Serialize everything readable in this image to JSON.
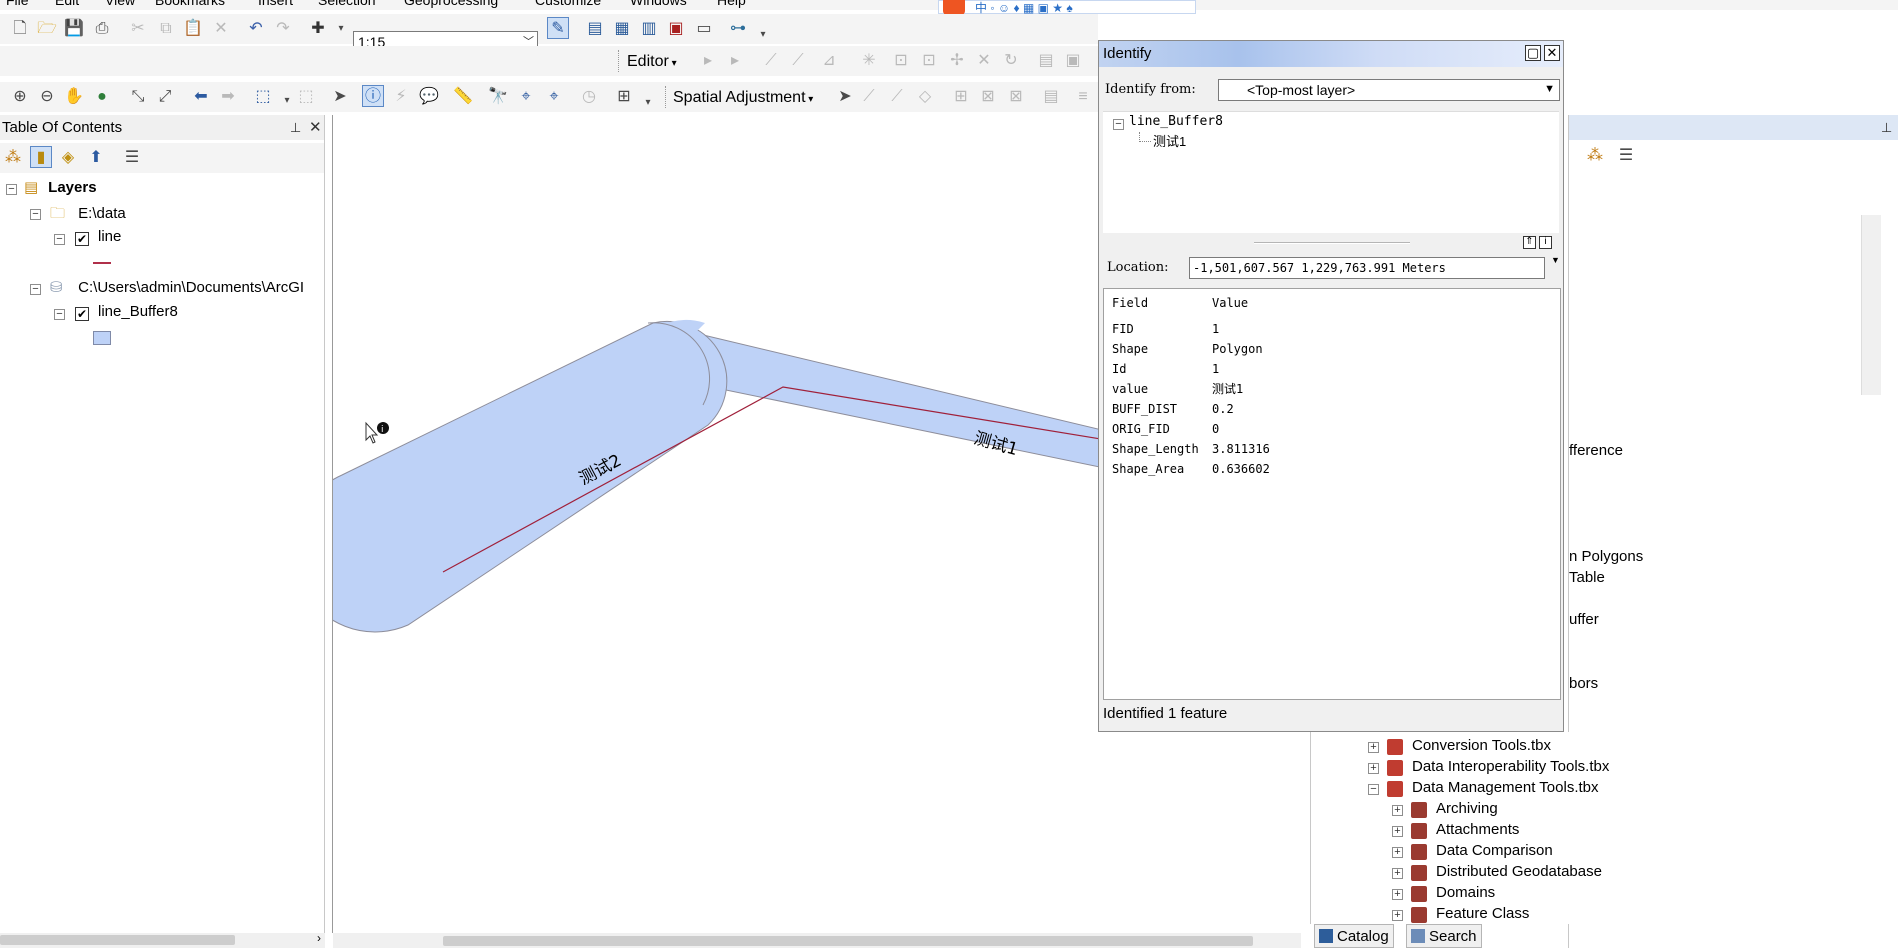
{
  "menubar": {
    "items": [
      "File",
      "Edit",
      "View",
      "Bookmarks",
      "Insert",
      "Selection",
      "Geoprocessing",
      "Customize",
      "Windows",
      "Help"
    ]
  },
  "toolbar": {
    "scale_value": "1:15",
    "editor_label": "Editor",
    "spatial_adjustment_label": "Spatial Adjustment"
  },
  "toc": {
    "title": "Table Of Contents",
    "layers_label": "Layers",
    "folder1_label": "E:\\data",
    "layer1_label": "line",
    "folder2_label": "C:\\Users\\admin\\Documents\\ArcGI",
    "layer2_label": "line_Buffer8",
    "line_color": "#b0304a",
    "fill_color": "#bed2f7"
  },
  "map": {
    "label_1": "测试1",
    "label_2": "测试2",
    "buffer_fill": "#bed2f7",
    "buffer_stroke": "#8d8d9a",
    "line_color": "#a0203a"
  },
  "identify": {
    "title": "Identify",
    "identify_from_label": "Identify from:",
    "identify_from_value": "<Top-most layer>",
    "tree_layer": "line_Buffer8",
    "tree_feature": "测试1",
    "location_label": "Location:",
    "location_value": "-1,501,607.567  1,229,763.991 Meters",
    "header_field": "Field",
    "header_value": "Value",
    "rows": [
      {
        "field": "FID",
        "value": "1"
      },
      {
        "field": "Shape",
        "value": "Polygon"
      },
      {
        "field": "Id",
        "value": "1"
      },
      {
        "field": "value",
        "value": "测试1"
      },
      {
        "field": "BUFF_DIST",
        "value": "0.2"
      },
      {
        "field": "ORIG_FID",
        "value": "0"
      },
      {
        "field": "Shape_Length",
        "value": "3.811316"
      },
      {
        "field": "Shape_Area",
        "value": "0.636602"
      }
    ],
    "status": "Identified 1 feature"
  },
  "catalog": {
    "partial_items": [
      "fference",
      "n Polygons",
      "Table",
      "uffer",
      "bors"
    ],
    "items": [
      {
        "label": "Conversion Tools.tbx"
      },
      {
        "label": "Data Interoperability Tools.tbx"
      },
      {
        "label": "Data Management Tools.tbx"
      }
    ],
    "subitems": [
      "Archiving",
      "Attachments",
      "Data Comparison",
      "Distributed Geodatabase",
      "Domains",
      "Feature Class"
    ],
    "tab_catalog": "Catalog",
    "tab_search": "Search"
  }
}
